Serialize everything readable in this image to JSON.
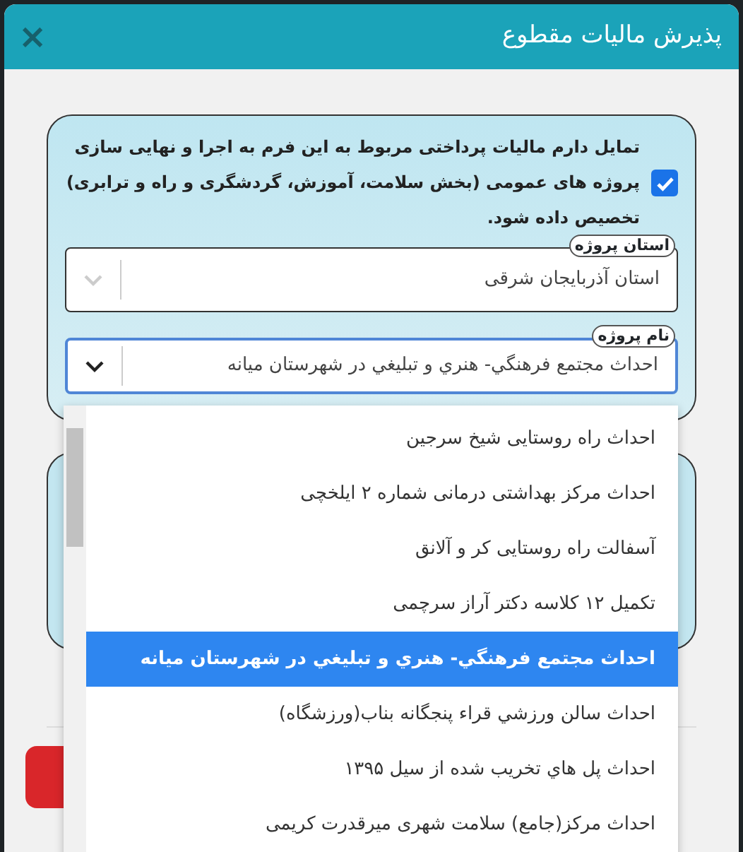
{
  "dialog": {
    "title": "پذیرش مالیات مقطوع",
    "close": "×"
  },
  "consent": {
    "checked": true,
    "text": "تمایل دارم مالیات پرداختی مربوط به این فرم به اجرا و نهایی سازی پروژه های عمومی (بخش سلامت، آموزش، گردشگری و راه و ترابری) تخصیص داده شود."
  },
  "fields": [
    {
      "label": "استان پروژه",
      "value": "استان آذربایجان شرقی",
      "focused": false
    },
    {
      "label": "نام پروژه",
      "value": "احداث مجتمع فرهنگي- هنري و تبليغي در شهرستان میانه",
      "focused": true
    }
  ],
  "dropdown": {
    "options": [
      {
        "text": "احداث راه روستایی شیخ سرجین",
        "selected": false
      },
      {
        "text": "احداث مرکز بهداشتی درمانی شماره ۲ ایلخچی",
        "selected": false
      },
      {
        "text": "آسفالت راه روستایی کر و آلانق",
        "selected": false
      },
      {
        "text": "تکمیل ۱۲ کلاسه دکتر آراز سرچمی",
        "selected": false
      },
      {
        "text": "احداث مجتمع فرهنگي- هنري و تبليغي در شهرستان میانه",
        "selected": true
      },
      {
        "text": "احداث سالن ورزشي قراء پنجگانه بناب(ورزشگاه)",
        "selected": false
      },
      {
        "text": "احداث پل هاي تخریب شده از سیل ۱۳۹۵",
        "selected": false
      },
      {
        "text": "احداث مرکز(جامع) سلامت شهری میرقدرت کریمی",
        "selected": false
      }
    ]
  }
}
